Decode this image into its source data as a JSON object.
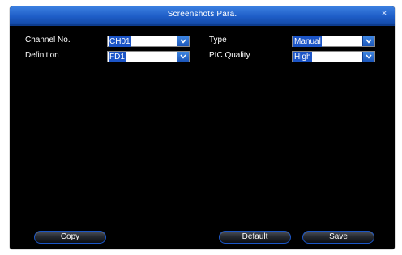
{
  "window": {
    "title": "Screenshots Para.",
    "close_glyph": "×"
  },
  "fields": {
    "channel": {
      "label": "Channel No.",
      "value": "CH01"
    },
    "type": {
      "label": "Type",
      "value": "Manual"
    },
    "definition": {
      "label": "Definition",
      "value": "FD1"
    },
    "pic_quality": {
      "label": "PIC Quality",
      "value": "High"
    }
  },
  "buttons": {
    "copy": "Copy",
    "default": "Default",
    "save": "Save"
  },
  "colors": {
    "titlebar": "#1f5ec8",
    "background": "#000000",
    "accent": "#1c55c7"
  }
}
